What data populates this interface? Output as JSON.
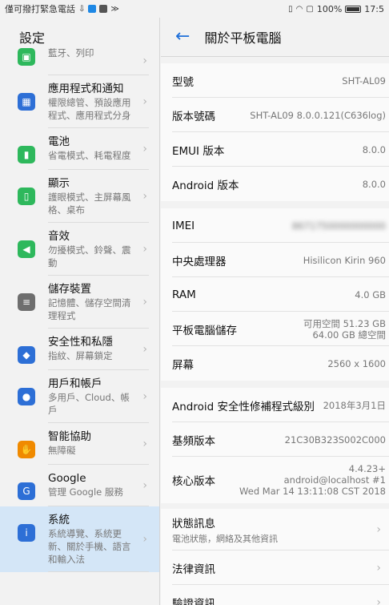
{
  "status_bar": {
    "left_text": "僅可撥打緊急電話",
    "right_text": "100%",
    "time": "17:5"
  },
  "left_pane": {
    "title": "設定",
    "items": [
      {
        "title": "",
        "sub": "藍牙、列印",
        "color": "#2eb85c",
        "icon": "device-connection-icon"
      },
      {
        "title": "應用程式和通知",
        "sub": "權限總管、預設應用程式、應用程式分身",
        "color": "#2d6fd6",
        "icon": "apps-icon"
      },
      {
        "title": "電池",
        "sub": "省電模式、耗電程度",
        "color": "#2eb85c",
        "icon": "battery-icon"
      },
      {
        "title": "顯示",
        "sub": "護眼模式、主屏幕風格、桌布",
        "color": "#2eb85c",
        "icon": "display-icon"
      },
      {
        "title": "音效",
        "sub": "勿擾模式、鈴聲、震動",
        "color": "#2eb85c",
        "icon": "sound-icon"
      },
      {
        "title": "儲存裝置",
        "sub": "記憶體、儲存空間清理程式",
        "color": "#6e6e6e",
        "icon": "storage-icon"
      },
      {
        "title": "安全性和私隱",
        "sub": "指紋、屏幕鎖定",
        "color": "#2d6fd6",
        "icon": "shield-icon"
      },
      {
        "title": "用戶和帳戶",
        "sub": "多用戶、Cloud、帳戶",
        "color": "#2d6fd6",
        "icon": "user-icon"
      },
      {
        "title": "智能協助",
        "sub": "無障礙",
        "color": "#f08a00",
        "icon": "hand-icon"
      },
      {
        "title": "Google",
        "sub": "管理 Google 服務",
        "color": "#2d6fd6",
        "icon": "google-icon"
      },
      {
        "title": "系統",
        "sub": "系統導覽、系統更新、關於手機、語言和輸入法",
        "color": "#2d6fd6",
        "icon": "system-info-icon"
      }
    ]
  },
  "right_pane": {
    "title": "關於平板電腦",
    "group1": [
      {
        "label": "型號",
        "value": "SHT-AL09"
      },
      {
        "label": "版本號碼",
        "value": "SHT-AL09 8.0.0.121(C636log)"
      },
      {
        "label": "EMUI 版本",
        "value": "8.0.0"
      },
      {
        "label": "Android 版本",
        "value": "8.0.0"
      }
    ],
    "group2": [
      {
        "label": "IMEI",
        "value": "8671750000000000"
      },
      {
        "label": "中央處理器",
        "value": "Hisilicon Kirin 960"
      },
      {
        "label": "RAM",
        "value": "4.0 GB"
      },
      {
        "label": "平板電腦儲存",
        "value_line1": "可用空間 51.23  GB",
        "value_line2": "64.00  GB 總空間"
      },
      {
        "label": "屏幕",
        "value": "2560 x 1600"
      }
    ],
    "group3": [
      {
        "label": "Android 安全性修補程式級別",
        "value": "2018年3月1日"
      },
      {
        "label": "基頻版本",
        "value": "21C30B323S002C000"
      },
      {
        "label": "核心版本",
        "value_line1": "4.4.23+",
        "value_line2": "android@localhost #1",
        "value_line3": "Wed Mar 14 13:11:08 CST 2018"
      }
    ],
    "group4": [
      {
        "label": "狀態訊息",
        "sub": "電池狀態，網絡及其他資訊"
      },
      {
        "label": "法律資訊"
      },
      {
        "label": "驗證資訊"
      }
    ]
  }
}
